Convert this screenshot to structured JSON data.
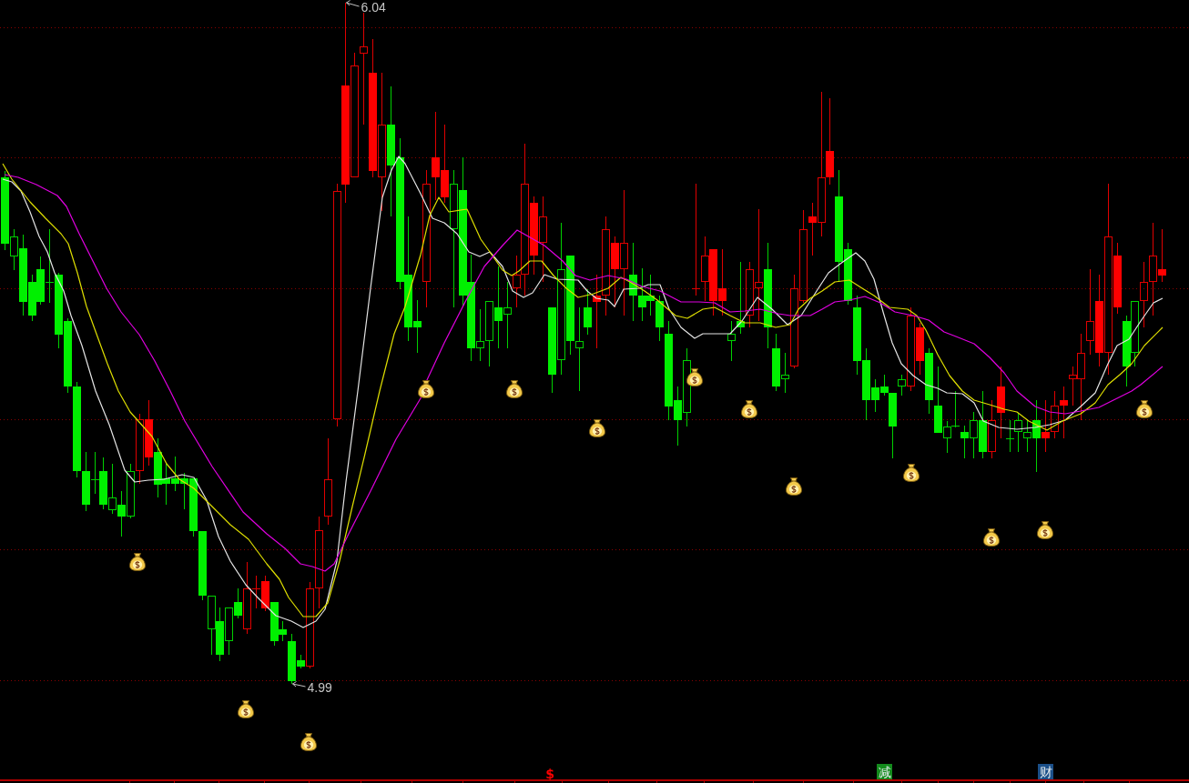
{
  "chart": {
    "price_labels": [
      {
        "kind": "high",
        "text": "6.04"
      },
      {
        "kind": "low",
        "text": "4.99"
      }
    ]
  },
  "signal_markers": [
    {
      "kind": "plain",
      "text": "$",
      "color": "#ff0000"
    },
    {
      "kind": "tile",
      "text": "减",
      "color": "#138a1c"
    },
    {
      "kind": "tile",
      "text": "财",
      "color": "#1b4f88"
    }
  ]
}
